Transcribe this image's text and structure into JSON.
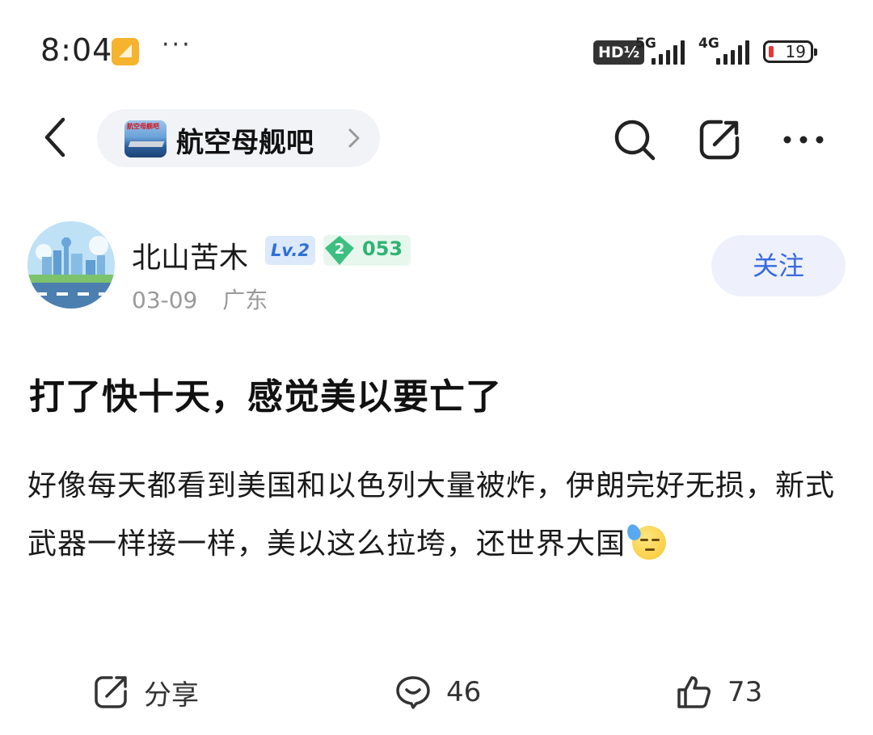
{
  "status_bar": {
    "time": "8:04",
    "more": "···",
    "hd_badge": "HD½",
    "network_1": "5G",
    "network_2": "4G",
    "battery": "19"
  },
  "nav": {
    "forum_name": "航空母舰吧",
    "forum_avatar_text": "航空母舰吧",
    "icons": [
      "back-icon",
      "search-icon",
      "share-icon",
      "more-icon"
    ]
  },
  "author": {
    "name": "北山苦木",
    "level": "Lv.2",
    "gem_level": "2",
    "gem_count": "053",
    "date": "03-09",
    "location": "广东",
    "follow_label": "关注"
  },
  "post": {
    "title": "打了快十天，感觉美以要亡了",
    "body": "好像每天都看到美国和以色列大量被炸，伊朗完好无损，新式武器一样接一样，美以这么拉垮，还世界大国",
    "emoji": "sweat-emoji"
  },
  "actions": {
    "share_label": "分享",
    "comment_count": "46",
    "like_count": "73"
  },
  "colors": {
    "accent": "#3a6ae0",
    "chip_bg": "#f2f3f7",
    "meta_text": "#9a9a9a",
    "gem_green": "#2fb374"
  }
}
